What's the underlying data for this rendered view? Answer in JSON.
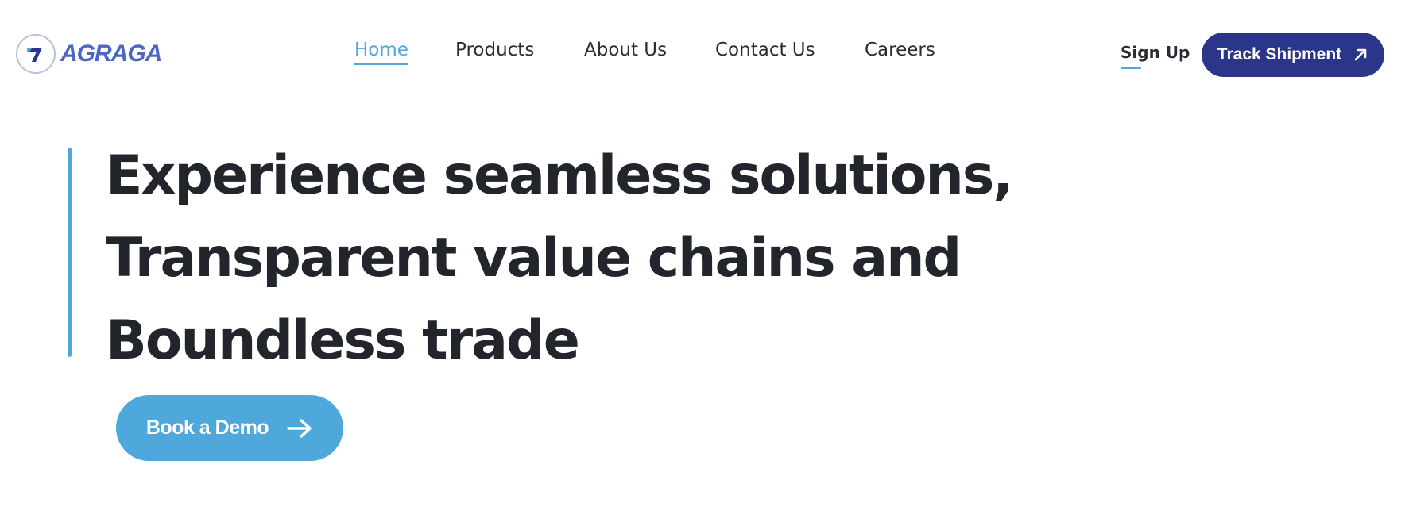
{
  "brand": {
    "name": "AGRAGA",
    "logo_icon": "agraga-arrow-icon",
    "colors": {
      "primary": "#2b3589",
      "accent": "#4fa8dc",
      "wordmark": "#4a67c4",
      "text": "#22252b"
    }
  },
  "nav": {
    "items": [
      {
        "label": "Home",
        "active": true
      },
      {
        "label": "Products",
        "active": false
      },
      {
        "label": "About Us",
        "active": false
      },
      {
        "label": "Contact Us",
        "active": false
      },
      {
        "label": "Careers",
        "active": false
      }
    ]
  },
  "header": {
    "signup_label": "Sign Up",
    "track_label": "Track Shipment",
    "track_icon": "arrow-up-right-icon"
  },
  "hero": {
    "lines": [
      "Experience seamless solutions,",
      "Transparent value chains and",
      "Boundless trade"
    ],
    "cta_label": "Book a Demo",
    "cta_icon": "arrow-right-icon"
  }
}
